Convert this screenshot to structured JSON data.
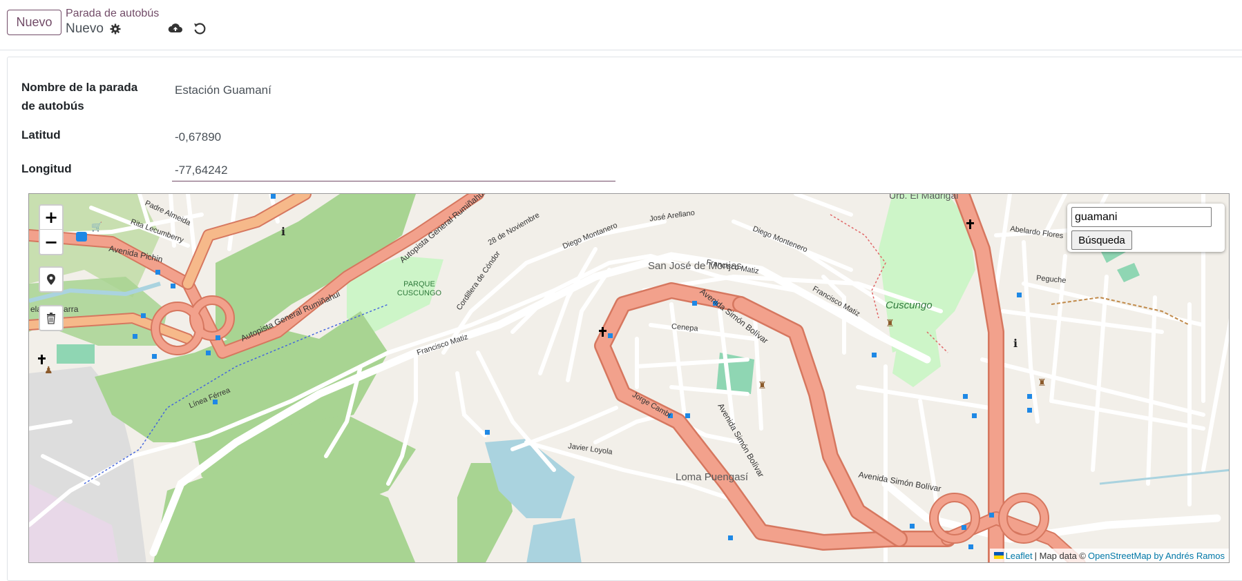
{
  "toolbar": {
    "new_label": "Nuevo",
    "breadcrumb": "Parada de autobús",
    "record_name": "Nuevo"
  },
  "form": {
    "name_label": "Nombre de la parada de autobús",
    "name_value": "Estación Guamaní",
    "lat_label": "Latitud",
    "lat_value": "-0,67890",
    "lng_label": "Longitud",
    "lng_value": "-77,64242"
  },
  "map": {
    "zoom_in": "+",
    "zoom_out": "−",
    "search_value": "guamani",
    "search_button": "Búsqueda",
    "attribution": {
      "leaflet": "Leaflet",
      "sep": "| Map data ©",
      "osm": "OpenStreetMap by Andrés Ramos"
    },
    "labels": {
      "park": "PARQUE CUSCUNGO",
      "san_jose": "San José de Monjas",
      "cuscungo": "Cuscungo",
      "loma": "Loma Puengasí",
      "madrigal": "Urb. El Madrigal",
      "av_pichincha": "Avenida Pichin",
      "autopista": "Autopista General Rumiñahui",
      "autopista_2": "Autopista General Rumiñahui",
      "av_simon_1": "Avenida Simón Bolívar",
      "av_simon_2": "Avenida Simón Bolívar",
      "av_simon_3": "Avenida Simón Bolívar",
      "francisco_matiz_1": "Francisco Matiz",
      "francisco_matiz_2": "Francisco Matiz",
      "francisco_matiz_3": "Francisco Matiz",
      "diego_montenero": "Diego Montenero",
      "diego_montanero": "Diego Montanero",
      "jose_arellano": "José Arellano",
      "javier_loyola": "Javier Loyola",
      "jorge_cambi": "Jorge Cambi",
      "linea_ferrea": "Línea Férrea",
      "velasco_ibarra": "elasco Ibarra",
      "rita_lecumberry": "Rita Lecumberry",
      "padre_almeida": "Padre Almeida",
      "cordillera": "Cordillera de Cóndor",
      "peguche": "Peguche",
      "cenepa": "Cenepa",
      "abelardo_flores": "Abelardo Flores",
      "noviembre": "28 de Noviembre"
    }
  },
  "colors": {
    "accent": "#714b67",
    "motorway": "#f2a18c",
    "motorway_border": "#d6775f",
    "park": "#a8d492",
    "water": "#aad3df",
    "background": "#f2efe9"
  }
}
